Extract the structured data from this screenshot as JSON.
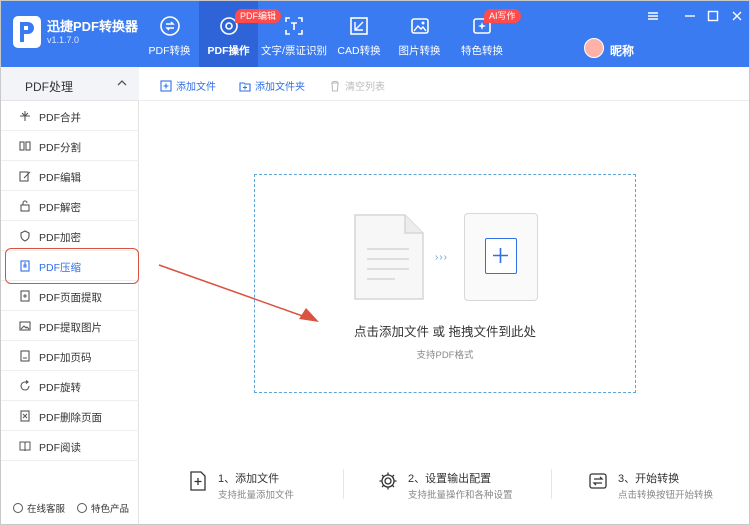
{
  "app": {
    "name": "迅捷PDF转换器",
    "version": "v1.1.7.0"
  },
  "nav": {
    "tabs": [
      {
        "label": "PDF转换"
      },
      {
        "label": "PDF操作",
        "badge": "PDF编辑",
        "active": true
      },
      {
        "label": "文字/票证识别"
      },
      {
        "label": "CAD转换"
      },
      {
        "label": "图片转换"
      },
      {
        "label": "特色转换",
        "badge": "AI写作"
      }
    ]
  },
  "user": {
    "name": "昵称"
  },
  "sidebar": {
    "title": "PDF处理",
    "items": [
      {
        "label": "PDF合并"
      },
      {
        "label": "PDF分割"
      },
      {
        "label": "PDF编辑"
      },
      {
        "label": "PDF解密"
      },
      {
        "label": "PDF加密"
      },
      {
        "label": "PDF压缩",
        "active": true
      },
      {
        "label": "PDF页面提取"
      },
      {
        "label": "PDF提取图片"
      },
      {
        "label": "PDF加页码"
      },
      {
        "label": "PDF旋转"
      },
      {
        "label": "PDF删除页面"
      },
      {
        "label": "PDF阅读"
      }
    ],
    "footer": {
      "online_service": "在线客服",
      "featured_products": "特色产品"
    }
  },
  "toolbar": {
    "add_file": "添加文件",
    "add_folder": "添加文件夹",
    "clear_list": "清空列表"
  },
  "dropzone": {
    "main_text": "点击添加文件 或 拖拽文件到此处",
    "sub_text": "支持PDF格式",
    "arrows": "›››"
  },
  "steps": [
    {
      "title": "1、添加文件",
      "desc": "支持批量添加文件"
    },
    {
      "title": "2、设置输出配置",
      "desc": "支持批量操作和各种设置"
    },
    {
      "title": "3、开始转换",
      "desc": "点击转换按钮开始转换"
    }
  ],
  "colors": {
    "primary": "#3b7bf2",
    "active_tab": "#2f64d8",
    "accent_text": "#2f6fe8",
    "annotation": "#d9533f",
    "badge": "#ff4b4b"
  }
}
